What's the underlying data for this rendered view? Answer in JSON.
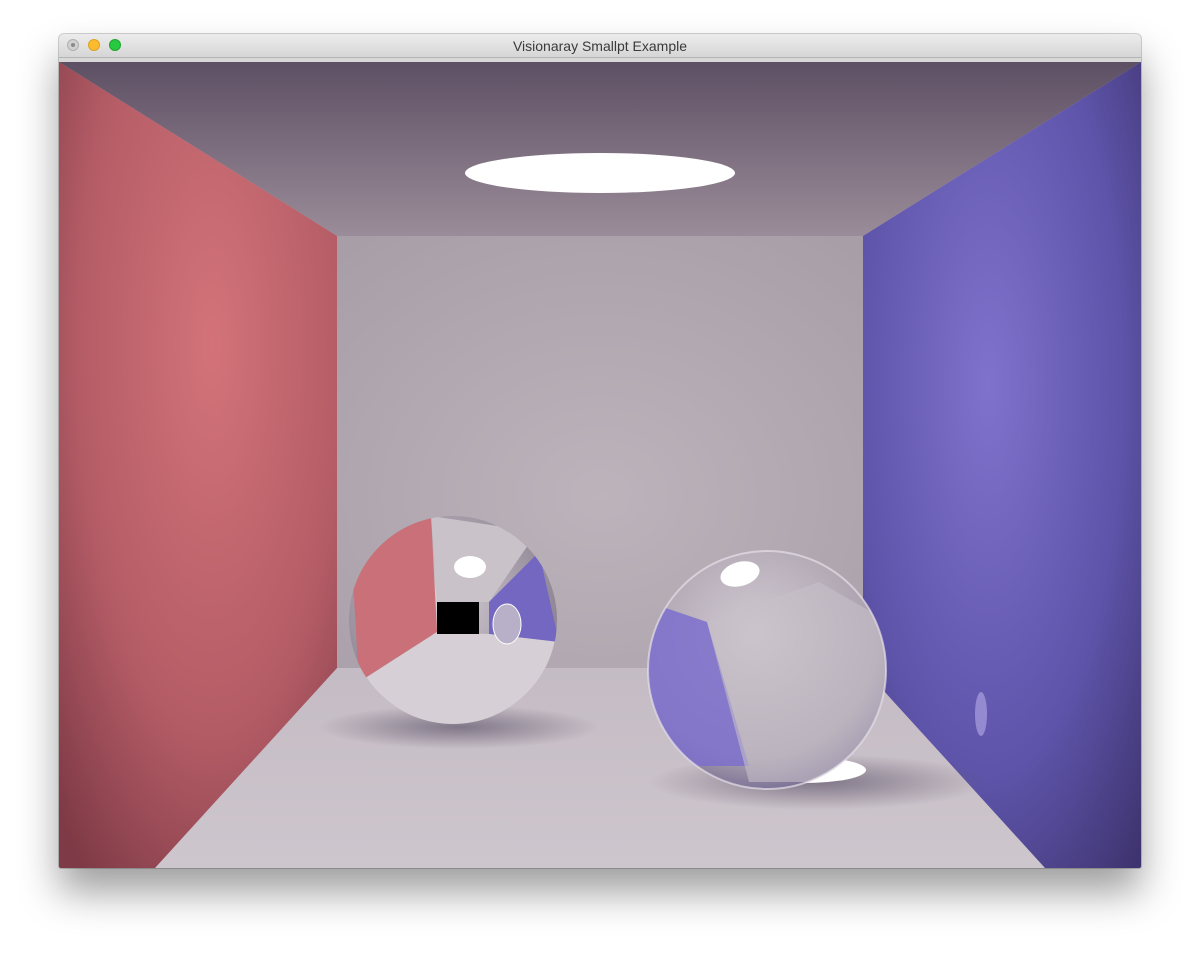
{
  "window": {
    "title": "Visionaray Smallpt Example",
    "controls": {
      "close": "close-button",
      "minimize": "minimize-button",
      "maximize": "maximize-button"
    }
  },
  "scene": {
    "description_icon": "render-viewport",
    "colors": {
      "left_wall": "#c46a72",
      "right_wall": "#6a5fc0",
      "back_wall": "#b6adb5",
      "ceiling": "#8e7e8c",
      "floor": "#c9c0c8",
      "light": "#ffffff",
      "traffic_close": "#d0d0d0",
      "traffic_min": "#fdbc2e",
      "traffic_max": "#28c840"
    }
  }
}
